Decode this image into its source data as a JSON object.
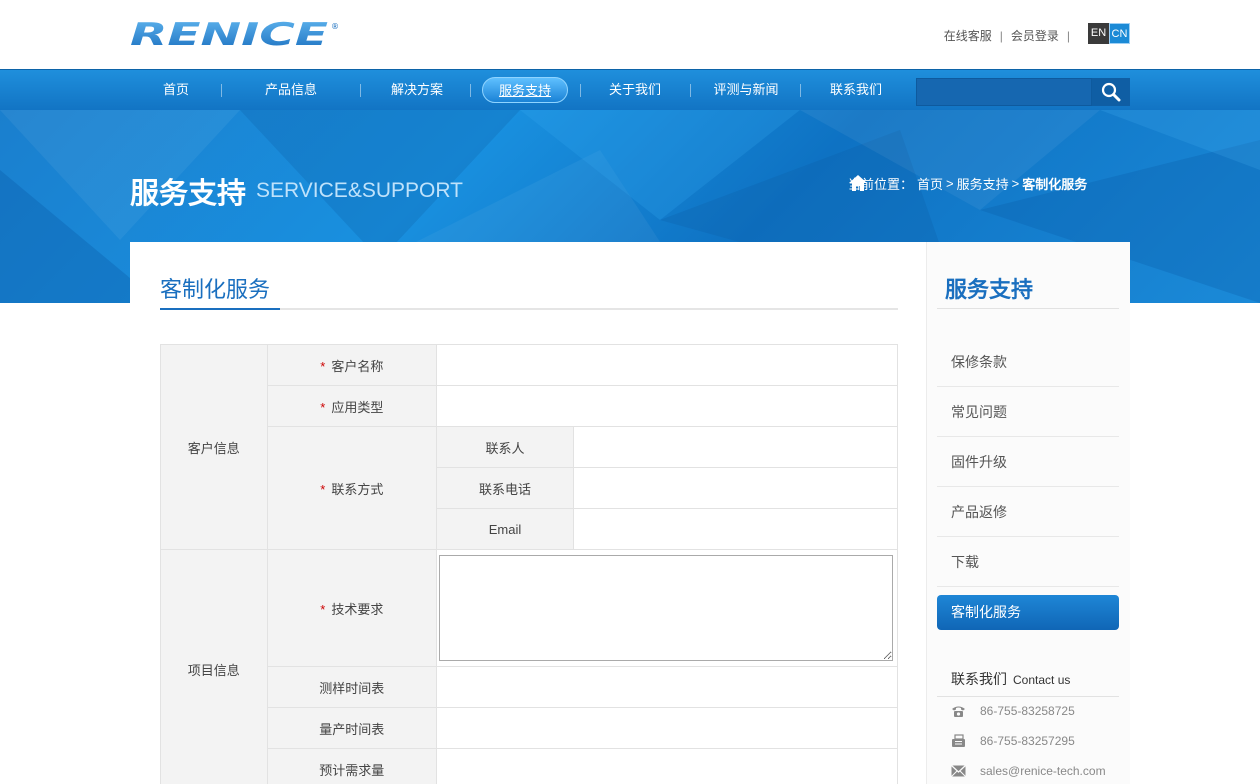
{
  "header": {
    "brand": "RENICE",
    "links": [
      "在线客服",
      "会员登录"
    ],
    "lang_en": "EN",
    "lang_cn": "CN"
  },
  "nav": {
    "items": [
      "首页",
      "产品信息",
      "解决方案",
      "服务支持",
      "关于我们",
      "评测与新闻",
      "联系我们"
    ],
    "active_index": 3,
    "search_placeholder": ""
  },
  "banner": {
    "title": "服务支持",
    "subtitle": "SERVICE&SUPPORT",
    "crumb_prefix": "当前位置：",
    "crumb_home": "首页",
    "crumb_sep": ">",
    "crumb_section": "服务支持",
    "crumb_current": "客制化服务"
  },
  "main": {
    "title": "客制化服务",
    "form": {
      "group_customer": "客户信息",
      "group_project": "项目信息",
      "customer_name": "客户名称",
      "app_type": "应用类型",
      "contact_method": "联系方式",
      "contact_person": "联系人",
      "contact_phone": "联系电话",
      "contact_email": "Email",
      "tech_req": "技术要求",
      "sample_time": "测样时间表",
      "mass_time": "量产时间表",
      "demand": "预计需求量",
      "required_mark": "*"
    }
  },
  "sidebar": {
    "title": "服务支持",
    "items": [
      "保修条款",
      "常见问题",
      "固件升级",
      "产品返修",
      "下载",
      "客制化服务"
    ],
    "active_index": 5,
    "contact_title": "联系我们",
    "contact_title_en": "Contact us",
    "phone": "86-755-83258725",
    "fax": "86-755-83257295",
    "email": "sales@renice-tech.com"
  }
}
